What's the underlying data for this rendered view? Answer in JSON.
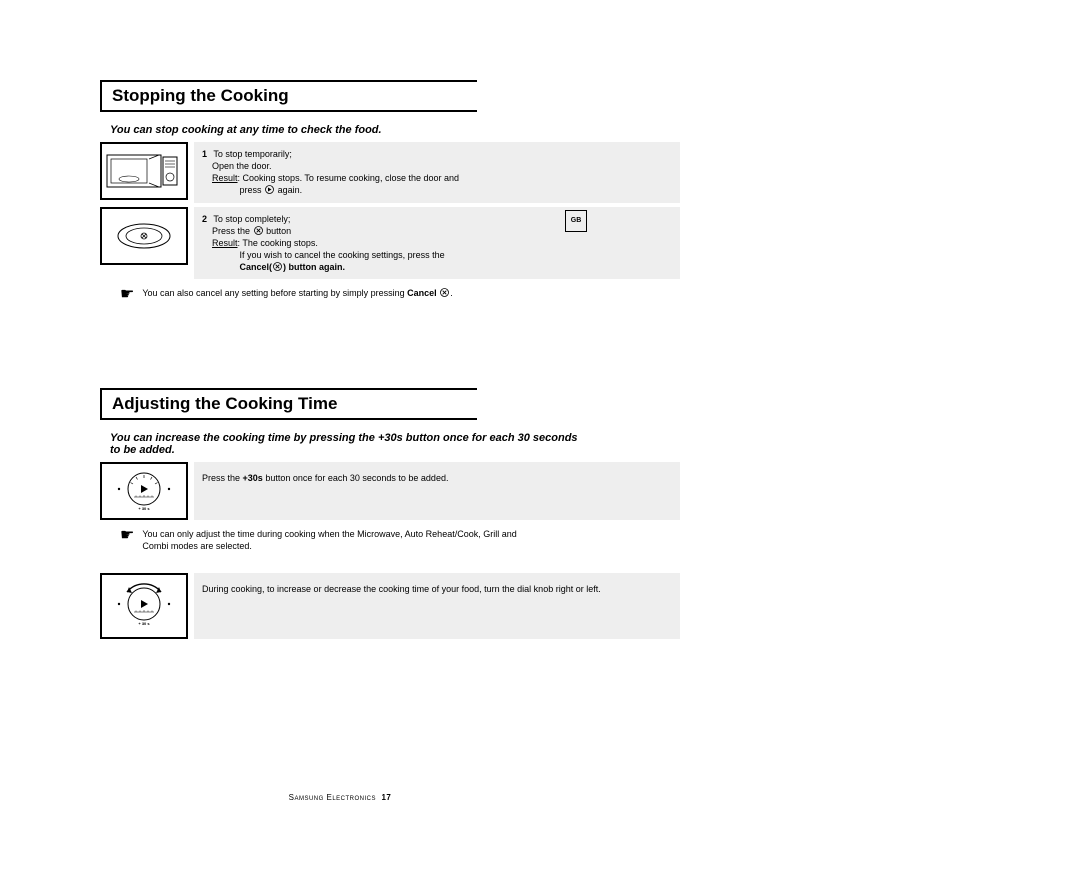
{
  "badge": "GB",
  "section1": {
    "title": "Stopping the Cooking",
    "intro": "You can stop cooking at any time to check the food.",
    "step1": {
      "num": "1",
      "l1": "To stop temporarily;",
      "l2": "Open the door.",
      "l3a": "Result",
      "l3b": ": Cooking stops. To resume cooking, close the door and",
      "l4": "press",
      "l4b": "again."
    },
    "step2": {
      "num": "2",
      "l1": "To stop completely;",
      "l2a": "Press the",
      "l2b": "button",
      "l3a": "Result",
      "l3b": ": The cooking stops.",
      "l4": "If you wish to cancel the cooking settings, press the",
      "l5a": "Cancel(",
      "l5b": ") button again."
    },
    "note": {
      "t1": "You can also cancel any setting before starting by simply pressing ",
      "t2": "Cancel",
      "t3": "."
    }
  },
  "section2": {
    "title": "Adjusting the Cooking Time",
    "intro": "You can increase the cooking time by pressing the +30s button once for each 30 seconds to be added.",
    "row1": {
      "t1": "Press the ",
      "t2": "+30s",
      "t3": " button once for each 30 seconds to be added."
    },
    "note": "You can only adjust the time during cooking when the Microwave, Auto Reheat/Cook, Grill and Combi modes are selected.",
    "row2": "During cooking, to increase or decrease the cooking time of your food, turn the dial knob right or left."
  },
  "dial_label": "+ 30 s",
  "footer": {
    "brand": "Samsung Electronics",
    "page": "17"
  }
}
